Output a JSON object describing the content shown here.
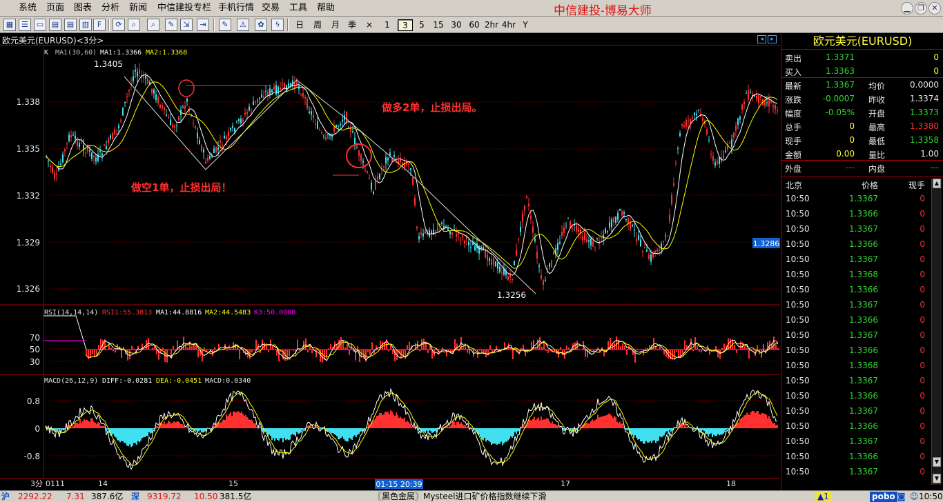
{
  "menu": [
    "系统",
    "页面",
    "图表",
    "分析",
    "新闻",
    "中信建投专栏",
    "手机行情",
    "交易",
    "工具",
    "帮助"
  ],
  "app_title": "中信建投-博易大师",
  "periods": [
    "日",
    "周",
    "月",
    "季",
    "×",
    "1",
    "3",
    "5",
    "15",
    "30",
    "60",
    "2hr",
    "4hr",
    "Y"
  ],
  "active_period": "3",
  "chart": {
    "title": "欧元美元(EURUSD)<3分>",
    "main_legend": {
      "k": "K",
      "ma": "MA1(30,60)",
      "ma1": "MA1:1.3366",
      "ma2": "MA2:1.3368"
    },
    "y_ticks": [
      "1.338",
      "1.335",
      "1.332",
      "1.329",
      "1.326"
    ],
    "high_label": "1.3405",
    "low_label": "1.3256",
    "current_price": "1.3286",
    "annotation_short": "做空1单，止损出局！",
    "annotation_long": "做多2单，止损出局。",
    "rsi_legend": {
      "name": "RSI(14,14,14)",
      "rsi1": "RSI1:55.3813",
      "ma1": "MA1:44.8816",
      "ma2": "MA2:44.5483",
      "k3": "K3:50.0000"
    },
    "rsi_ticks": [
      "70",
      "50",
      "30"
    ],
    "macd_legend": {
      "name": "MACD(26,12,9)",
      "diff": "DIFF:-0.0281",
      "dea": "DEA:-0.0451",
      "macd": "MACD:0.0340"
    },
    "macd_ticks": [
      "0.8",
      "0",
      "-0.8"
    ],
    "x_period": "3分",
    "x_labels": [
      "0111",
      "14",
      "15",
      "17",
      "18"
    ],
    "cursor_time": "01-15 20:39",
    "colors": {
      "up": "#ff3030",
      "down": "#40e0f0",
      "ma1": "#ffffff",
      "ma2": "#ffff00",
      "grid": "#8a0000",
      "magenta": "#ff00ff"
    }
  },
  "quote": {
    "title": "欧元美元(EURUSD)",
    "rows": [
      {
        "l1": "卖出",
        "v1": "1.3371",
        "c1": "#30d830",
        "l2": "",
        "v2": "0",
        "c2": "#ffff40"
      },
      {
        "l1": "买入",
        "v1": "1.3363",
        "c1": "#30d830",
        "l2": "",
        "v2": "0",
        "c2": "#ffff40"
      },
      {
        "l1": "最新",
        "v1": "1.3367",
        "c1": "#30d830",
        "l2": "均价",
        "v2": "0.0000",
        "c2": "#e6e6e6"
      },
      {
        "l1": "涨跌",
        "v1": "-0.0007",
        "c1": "#30d830",
        "l2": "昨收",
        "v2": "1.3374",
        "c2": "#e6e6e6"
      },
      {
        "l1": "幅度",
        "v1": "-0.05%",
        "c1": "#30d830",
        "l2": "开盘",
        "v2": "1.3373",
        "c2": "#30d830"
      },
      {
        "l1": "总手",
        "v1": "0",
        "c1": "#ffff40",
        "l2": "最高",
        "v2": "1.3380",
        "c2": "#ff3030"
      },
      {
        "l1": "现手",
        "v1": "0",
        "c1": "#ffff40",
        "l2": "最低",
        "v2": "1.3358",
        "c2": "#30d830"
      },
      {
        "l1": "金额",
        "v1": "0.00",
        "c1": "#ffff40",
        "l2": "量比",
        "v2": "1.00",
        "c2": "#e6e6e6"
      },
      {
        "l1": "外盘",
        "v1": "---",
        "c1": "#ff3030",
        "l2": "内盘",
        "v2": "---",
        "c2": "#30d830"
      }
    ],
    "ticks_header": {
      "time": "北京",
      "price": "价格",
      "vol": "现手"
    },
    "ticks": [
      {
        "t": "10:50",
        "p": "1.3367",
        "v": "0"
      },
      {
        "t": "10:50",
        "p": "1.3366",
        "v": "0"
      },
      {
        "t": "10:50",
        "p": "1.3367",
        "v": "0"
      },
      {
        "t": "10:50",
        "p": "1.3366",
        "v": "0"
      },
      {
        "t": "10:50",
        "p": "1.3367",
        "v": "0"
      },
      {
        "t": "10:50",
        "p": "1.3368",
        "v": "0"
      },
      {
        "t": "10:50",
        "p": "1.3366",
        "v": "0"
      },
      {
        "t": "10:50",
        "p": "1.3367",
        "v": "0"
      },
      {
        "t": "10:50",
        "p": "1.3366",
        "v": "0"
      },
      {
        "t": "10:50",
        "p": "1.3367",
        "v": "0"
      },
      {
        "t": "10:50",
        "p": "1.3366",
        "v": "0"
      },
      {
        "t": "10:50",
        "p": "1.3368",
        "v": "0"
      },
      {
        "t": "10:50",
        "p": "1.3367",
        "v": "0"
      },
      {
        "t": "10:50",
        "p": "1.3366",
        "v": "0"
      },
      {
        "t": "10:50",
        "p": "1.3367",
        "v": "0"
      },
      {
        "t": "10:50",
        "p": "1.3366",
        "v": "0"
      },
      {
        "t": "10:50",
        "p": "1.3367",
        "v": "0"
      },
      {
        "t": "10:50",
        "p": "1.3366",
        "v": "0"
      },
      {
        "t": "10:50",
        "p": "1.3367",
        "v": "0"
      }
    ]
  },
  "status": {
    "sh_label": "沪",
    "sh_index": "2292.22",
    "sh_change": "7.31",
    "sh_amount": "387.6亿",
    "sz_label": "深",
    "sz_index": "9319.72",
    "sz_change": "10.50",
    "sz_amount": "381.5亿",
    "news": "〖黑色金属〗Mysteel进口矿价格指数继续下滑",
    "alerts": "▲1",
    "brand": "pobo",
    "time": "10:50"
  }
}
